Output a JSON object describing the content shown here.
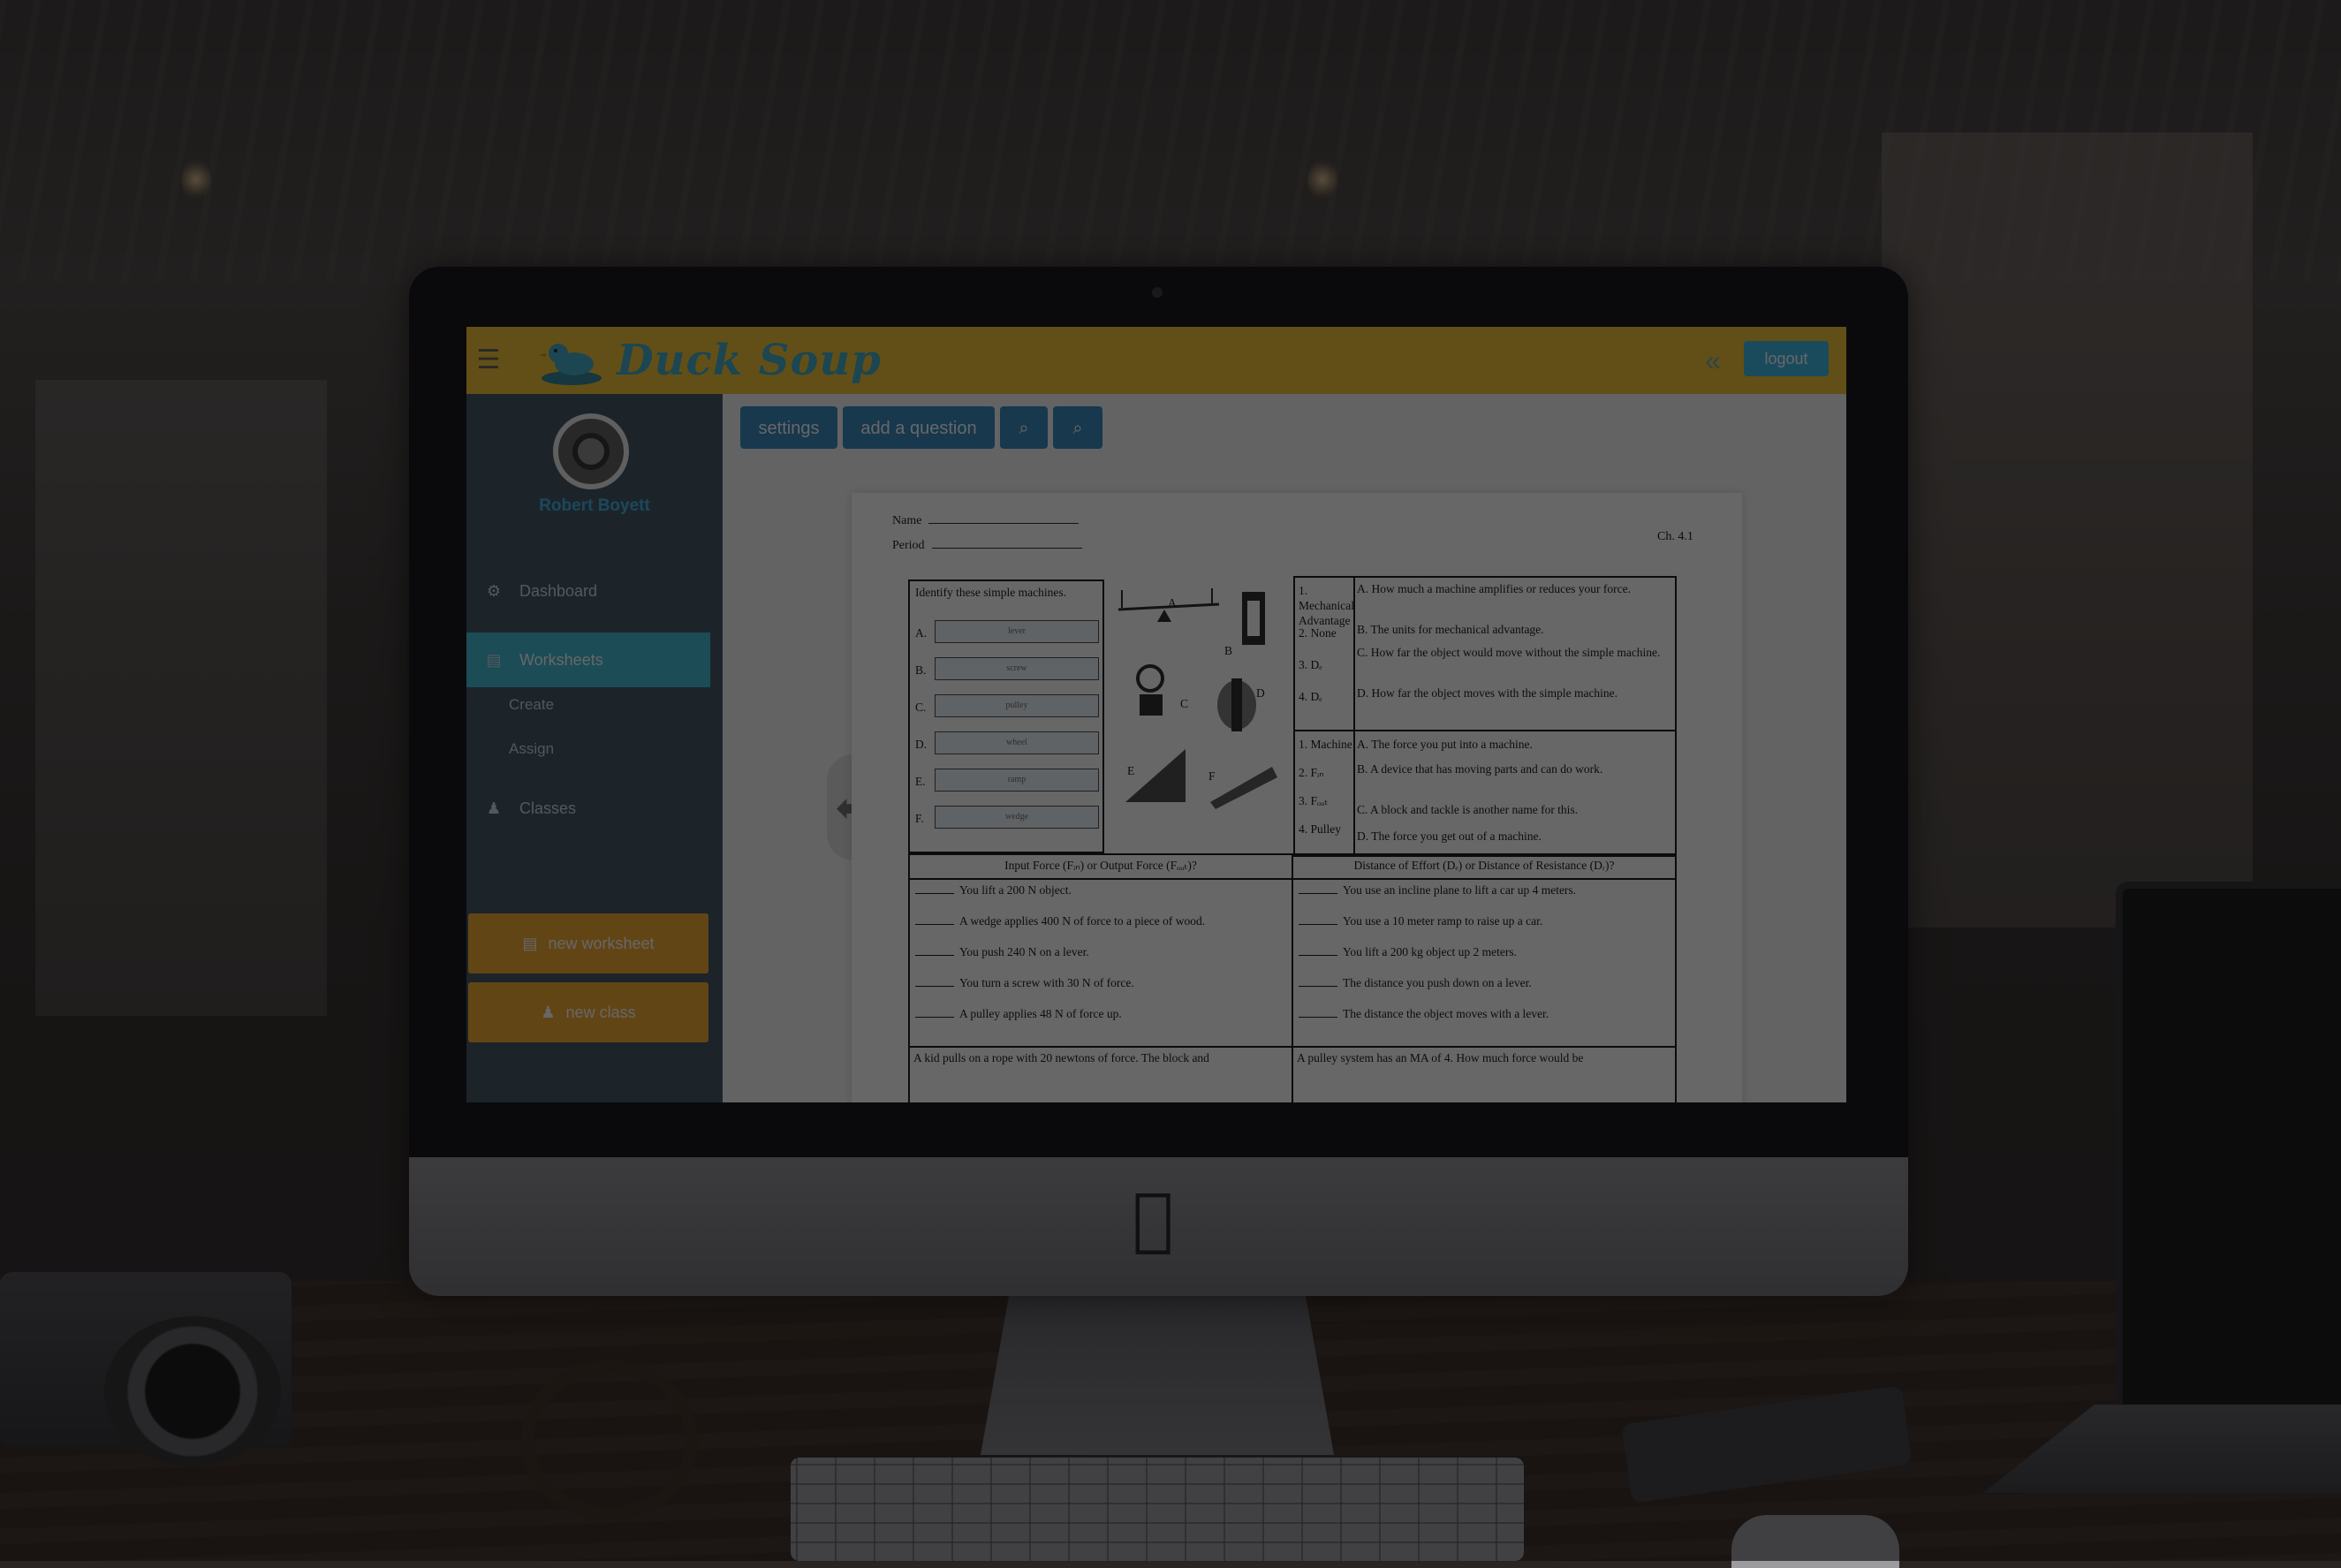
{
  "app": {
    "brand": "Duck Soup",
    "logout_label": "logout"
  },
  "sidebar": {
    "user_name": "Robert Boyett",
    "items": [
      {
        "label": "Dashboard",
        "icon": "dashboard-icon"
      },
      {
        "label": "Worksheets",
        "icon": "worksheet-icon",
        "active": true
      },
      {
        "label": "Classes",
        "icon": "users-icon"
      }
    ],
    "sub_items": [
      {
        "label": "Create"
      },
      {
        "label": "Assign"
      }
    ],
    "actions": [
      {
        "label": "new worksheet",
        "icon": "file-icon"
      },
      {
        "label": "new class",
        "icon": "users-icon"
      }
    ]
  },
  "toolbar": {
    "settings_label": "settings",
    "add_question_label": "add a question",
    "zoom_out_icon": "zoom-out-icon",
    "zoom_in_icon": "zoom-in-icon"
  },
  "worksheet": {
    "name_label": "Name",
    "period_label": "Period",
    "chapter": "Ch. 4.1",
    "identify_title": "Identify these simple machines.",
    "identify_letters": [
      "A.",
      "B.",
      "C.",
      "D.",
      "E.",
      "F."
    ],
    "identify_answers": [
      "lever",
      "screw",
      "pulley",
      "wheel",
      "ramp",
      "wedge"
    ],
    "figure_letters": [
      "A",
      "B",
      "C",
      "D",
      "E",
      "F"
    ],
    "match1_left": [
      "1. Mechanical Advantage",
      "2. None",
      "3. Dₑ",
      "4. Dₑ"
    ],
    "match1_right": [
      "A. How much a machine amplifies or reduces your force.",
      "B. The units for mechanical advantage.",
      "C. How far the object would move without the simple machine.",
      "D. How far the object moves with the simple machine."
    ],
    "match2_left": [
      "1. Machine",
      "2. Fᵢₙ",
      "3. Fₒᵤₜ",
      "4. Pulley"
    ],
    "match2_right": [
      "A. The force you put into a machine.",
      "B. A device that has moving parts and can do work.",
      "C. A block and tackle is another name for this.",
      "D. The force you get out of a machine."
    ],
    "force_header": "Input Force (Fᵢₙ) or Output Force (Fₒᵤₜ)?",
    "distance_header": "Distance of Effort (Dₑ) or Distance of Resistance (Dᵣ)?",
    "force_items": [
      "You lift a 200 N object.",
      "A wedge applies 400 N of force to a piece of wood.",
      "You push 240 N on a lever.",
      "You turn a screw with 30 N of force.",
      "A pulley applies 48 N of force up."
    ],
    "distance_items": [
      "You use an incline plane to lift a car up 4 meters.",
      "You use a 10 meter ramp to raise up a car.",
      "You lift a 200 kg object up 2 meters.",
      "The distance you push down on a lever.",
      "The distance the object moves with a lever."
    ],
    "problem_left": "A kid pulls on a rope with 20 newtons of force. The block and",
    "problem_right": "A pulley system has an MA of 4. How much force would be"
  }
}
